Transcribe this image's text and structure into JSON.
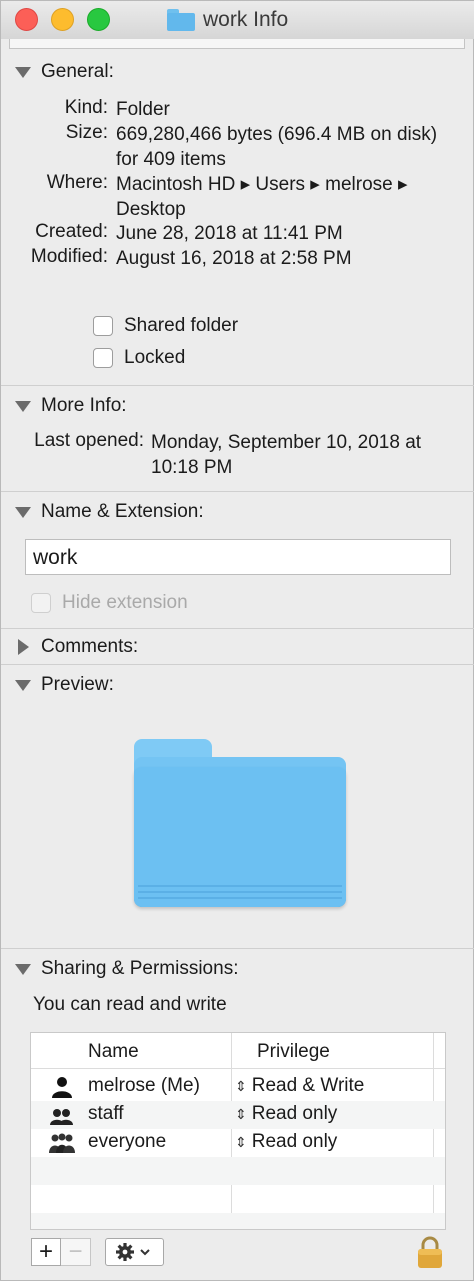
{
  "window": {
    "title": "work Info"
  },
  "general": {
    "header": "General:",
    "kind_label": "Kind:",
    "kind_value": "Folder",
    "size_label": "Size:",
    "size_value": "669,280,466 bytes (696.4 MB on disk) for 409 items",
    "where_label": "Where:",
    "where_value": "Macintosh HD ▸ Users ▸ melrose ▸ Desktop",
    "created_label": "Created:",
    "created_value": "June 28, 2018 at 11:41 PM",
    "modified_label": "Modified:",
    "modified_value": "August 16, 2018 at 2:58 PM",
    "shared_folder_label": "Shared folder",
    "locked_label": "Locked"
  },
  "more_info": {
    "header": "More Info:",
    "last_opened_label": "Last opened:",
    "last_opened_value": "Monday, September 10, 2018 at 10:18 PM"
  },
  "name_extension": {
    "header": "Name & Extension:",
    "name_value": "work",
    "hide_extension_label": "Hide extension"
  },
  "comments": {
    "header": "Comments:"
  },
  "preview": {
    "header": "Preview:"
  },
  "sharing": {
    "header": "Sharing & Permissions:",
    "summary": "You can read and write",
    "columns": {
      "name": "Name",
      "privilege": "Privilege"
    },
    "rows": [
      {
        "name": "melrose (Me)",
        "privilege": "Read & Write",
        "icon": "single-user-icon"
      },
      {
        "name": "staff",
        "privilege": "Read only",
        "icon": "group-icon"
      },
      {
        "name": "everyone",
        "privilege": "Read only",
        "icon": "everyone-icon"
      }
    ],
    "add_label": "+",
    "remove_label": "−"
  }
}
